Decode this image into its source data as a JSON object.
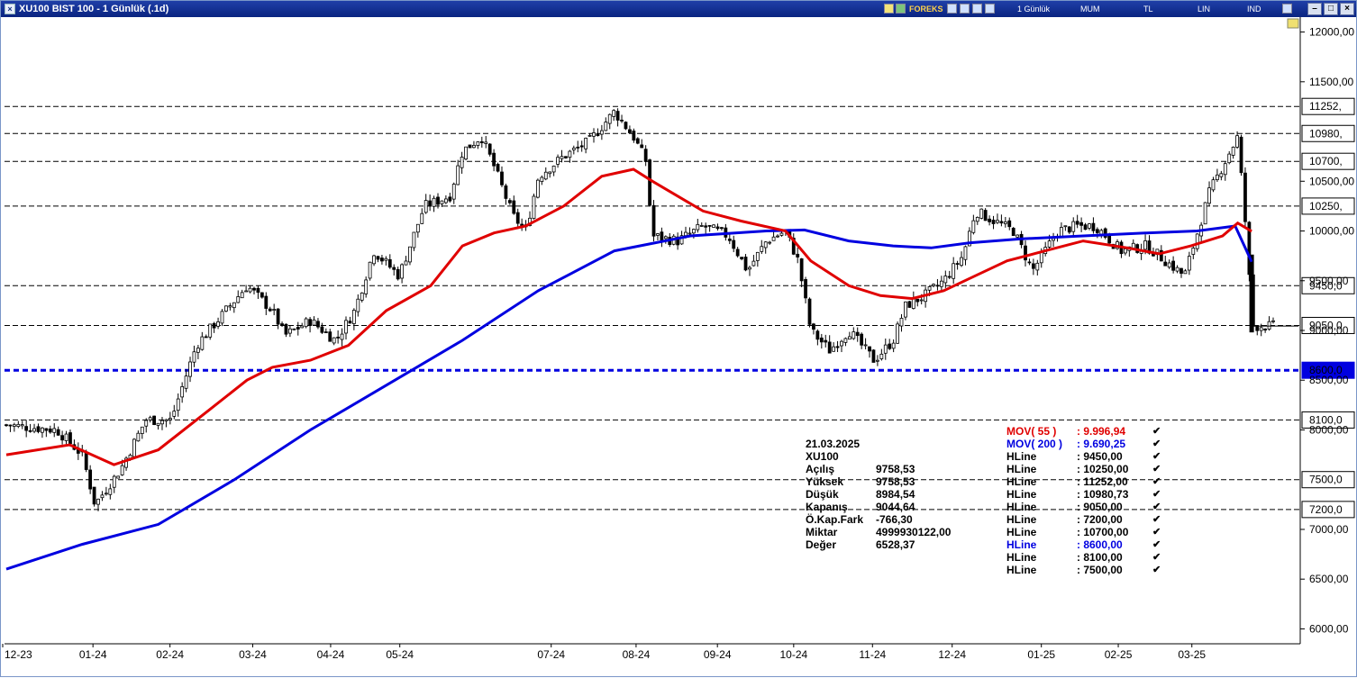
{
  "window": {
    "title": "XU100 BIST 100 - 1 Günlük (.1d)",
    "toolbar_labels": [
      "FOREKS",
      "1 Günlük",
      "MUM",
      "TL",
      "LIN",
      "IND"
    ]
  },
  "readout": {
    "date": "21.03.2025",
    "symbol": "XU100",
    "rows": [
      {
        "label": "Açılış",
        "value": "9758,53"
      },
      {
        "label": "Yüksek",
        "value": "9758,53"
      },
      {
        "label": "Düşük",
        "value": "8984,54"
      },
      {
        "label": "Kapanış",
        "value": "9044,64"
      },
      {
        "label": "Ö.Kap.Fark",
        "value": "-766,30"
      },
      {
        "label": "Miktar",
        "value": "4999930122,00"
      },
      {
        "label": "Değer",
        "value": "6528,37"
      }
    ]
  },
  "indicators": [
    {
      "label": "MOV( 55 )",
      "value": ": 9.996,94",
      "color": "#e00000"
    },
    {
      "label": "MOV( 200 )",
      "value": ": 9.690,25",
      "color": "#0000e0"
    },
    {
      "label": "HLine",
      "value": ": 9450,00",
      "color": "#000000"
    },
    {
      "label": "HLine",
      "value": ": 10250,00",
      "color": "#000000"
    },
    {
      "label": "HLine",
      "value": ": 11252,00",
      "color": "#000000"
    },
    {
      "label": "HLine",
      "value": ": 10980,73",
      "color": "#000000"
    },
    {
      "label": "HLine",
      "value": ": 9050,00",
      "color": "#000000"
    },
    {
      "label": "HLine",
      "value": ": 7200,00",
      "color": "#000000"
    },
    {
      "label": "HLine",
      "value": ": 10700,00",
      "color": "#000000"
    },
    {
      "label": "HLine",
      "value": ": 8600,00",
      "color": "#0000e0"
    },
    {
      "label": "HLine",
      "value": ": 8100,00",
      "color": "#000000"
    },
    {
      "label": "HLine",
      "value": ": 7500,00",
      "color": "#000000"
    }
  ],
  "chart_data": {
    "type": "candlestick",
    "symbol": "XU100",
    "ylim": [
      5850,
      12150
    ],
    "yticks": [
      {
        "v": 12000,
        "label": "12000,00"
      },
      {
        "v": 11500,
        "label": "11500,00"
      },
      {
        "v": 10500,
        "label": "10500,00"
      },
      {
        "v": 10000,
        "label": "10000,00"
      },
      {
        "v": 9500,
        "label": "9500,00"
      },
      {
        "v": 9000,
        "label": "9000,00"
      },
      {
        "v": 8500,
        "label": "8500,00"
      },
      {
        "v": 8000,
        "label": "8000,00"
      },
      {
        "v": 7000,
        "label": "7000,00"
      },
      {
        "v": 6500,
        "label": "6500,00"
      },
      {
        "v": 6000,
        "label": "6000,00"
      }
    ],
    "hlines": [
      {
        "v": 11252,
        "label": "11252,",
        "color": "#000000",
        "style": "dashed"
      },
      {
        "v": 10980,
        "label": "10980,",
        "color": "#000000",
        "style": "dashed"
      },
      {
        "v": 10700,
        "label": "10700,",
        "color": "#000000",
        "style": "dashed"
      },
      {
        "v": 10250,
        "label": "10250,",
        "color": "#000000",
        "style": "dashed"
      },
      {
        "v": 9450,
        "label": "9450,0",
        "color": "#000000",
        "style": "dashed"
      },
      {
        "v": 9050,
        "label": "9050,0",
        "color": "#000000",
        "style": "dashed"
      },
      {
        "v": 8600,
        "label": "8600,0",
        "color": "#0000e0",
        "style": "dashed-bold"
      },
      {
        "v": 8100,
        "label": "8100,0",
        "color": "#000000",
        "style": "dashed"
      },
      {
        "v": 7500,
        "label": "7500,0",
        "color": "#000000",
        "style": "dashed"
      },
      {
        "v": 7200,
        "label": "7200,0",
        "color": "#000000",
        "style": "dashed"
      }
    ],
    "xticks": [
      {
        "t": 0,
        "label": "12-23"
      },
      {
        "t": 0.0684,
        "label": "01-24"
      },
      {
        "t": 0.1292,
        "label": "02-24"
      },
      {
        "t": 0.1945,
        "label": "03-24"
      },
      {
        "t": 0.256,
        "label": "04-24"
      },
      {
        "t": 0.3106,
        "label": "05-24"
      },
      {
        "t": 0.4301,
        "label": "07-24"
      },
      {
        "t": 0.4971,
        "label": "08-24"
      },
      {
        "t": 0.5613,
        "label": "09-24"
      },
      {
        "t": 0.6215,
        "label": "10-24"
      },
      {
        "t": 0.6837,
        "label": "11-24"
      },
      {
        "t": 0.7466,
        "label": "12-24"
      },
      {
        "t": 0.817,
        "label": "01-25"
      },
      {
        "t": 0.8777,
        "label": "02-25"
      },
      {
        "t": 0.9358,
        "label": "03-25"
      }
    ],
    "close_path": [
      [
        0,
        8050
      ],
      [
        0.04,
        8000
      ],
      [
        0.06,
        7750
      ],
      [
        0.07,
        7250
      ],
      [
        0.09,
        7600
      ],
      [
        0.11,
        8100
      ],
      [
        0.13,
        8100
      ],
      [
        0.15,
        8850
      ],
      [
        0.17,
        9150
      ],
      [
        0.19,
        9450
      ],
      [
        0.21,
        9200
      ],
      [
        0.22,
        8950
      ],
      [
        0.24,
        9100
      ],
      [
        0.26,
        8900
      ],
      [
        0.275,
        9200
      ],
      [
        0.29,
        9800
      ],
      [
        0.31,
        9550
      ],
      [
        0.33,
        10250
      ],
      [
        0.35,
        10350
      ],
      [
        0.36,
        10800
      ],
      [
        0.375,
        10950
      ],
      [
        0.385,
        10650
      ],
      [
        0.4,
        10150
      ],
      [
        0.41,
        10000
      ],
      [
        0.42,
        10550
      ],
      [
        0.44,
        10750
      ],
      [
        0.46,
        10900
      ],
      [
        0.48,
        11200
      ],
      [
        0.495,
        10950
      ],
      [
        0.505,
        10700
      ],
      [
        0.51,
        9950
      ],
      [
        0.53,
        9900
      ],
      [
        0.55,
        10050
      ],
      [
        0.57,
        9950
      ],
      [
        0.585,
        9600
      ],
      [
        0.6,
        9900
      ],
      [
        0.615,
        10000
      ],
      [
        0.625,
        9700
      ],
      [
        0.635,
        9000
      ],
      [
        0.65,
        8800
      ],
      [
        0.665,
        9000
      ],
      [
        0.685,
        8700
      ],
      [
        0.7,
        8900
      ],
      [
        0.71,
        9250
      ],
      [
        0.725,
        9350
      ],
      [
        0.74,
        9500
      ],
      [
        0.755,
        9750
      ],
      [
        0.765,
        10200
      ],
      [
        0.78,
        10100
      ],
      [
        0.795,
        10000
      ],
      [
        0.81,
        9600
      ],
      [
        0.83,
        10000
      ],
      [
        0.845,
        10050
      ],
      [
        0.86,
        10050
      ],
      [
        0.88,
        9800
      ],
      [
        0.9,
        9850
      ],
      [
        0.915,
        9700
      ],
      [
        0.93,
        9550
      ],
      [
        0.95,
        10400
      ],
      [
        0.96,
        10650
      ],
      [
        0.972,
        10950
      ],
      [
        0.98,
        9800
      ],
      [
        0.983,
        9044
      ]
    ],
    "mov55_path": [
      [
        0,
        7750
      ],
      [
        0.05,
        7850
      ],
      [
        0.085,
        7650
      ],
      [
        0.12,
        7800
      ],
      [
        0.16,
        8200
      ],
      [
        0.19,
        8500
      ],
      [
        0.21,
        8630
      ],
      [
        0.24,
        8700
      ],
      [
        0.27,
        8850
      ],
      [
        0.3,
        9200
      ],
      [
        0.335,
        9450
      ],
      [
        0.36,
        9850
      ],
      [
        0.385,
        9980
      ],
      [
        0.41,
        10050
      ],
      [
        0.44,
        10250
      ],
      [
        0.47,
        10550
      ],
      [
        0.495,
        10620
      ],
      [
        0.51,
        10500
      ],
      [
        0.55,
        10200
      ],
      [
        0.58,
        10100
      ],
      [
        0.615,
        10000
      ],
      [
        0.635,
        9700
      ],
      [
        0.665,
        9450
      ],
      [
        0.69,
        9350
      ],
      [
        0.715,
        9320
      ],
      [
        0.74,
        9400
      ],
      [
        0.765,
        9550
      ],
      [
        0.79,
        9700
      ],
      [
        0.82,
        9800
      ],
      [
        0.85,
        9900
      ],
      [
        0.885,
        9830
      ],
      [
        0.91,
        9770
      ],
      [
        0.935,
        9850
      ],
      [
        0.96,
        9950
      ],
      [
        0.972,
        10080
      ],
      [
        0.983,
        9997
      ]
    ],
    "mov200_path": [
      [
        0,
        6600
      ],
      [
        0.06,
        6850
      ],
      [
        0.12,
        7050
      ],
      [
        0.18,
        7500
      ],
      [
        0.24,
        8000
      ],
      [
        0.3,
        8450
      ],
      [
        0.36,
        8900
      ],
      [
        0.42,
        9400
      ],
      [
        0.48,
        9800
      ],
      [
        0.54,
        9950
      ],
      [
        0.6,
        10000
      ],
      [
        0.63,
        10010
      ],
      [
        0.665,
        9900
      ],
      [
        0.7,
        9850
      ],
      [
        0.73,
        9830
      ],
      [
        0.76,
        9880
      ],
      [
        0.8,
        9920
      ],
      [
        0.85,
        9950
      ],
      [
        0.9,
        9980
      ],
      [
        0.94,
        10000
      ],
      [
        0.97,
        10050
      ],
      [
        0.983,
        9690
      ]
    ],
    "mov55_color": "#e00000",
    "mov200_color": "#0000e0"
  }
}
